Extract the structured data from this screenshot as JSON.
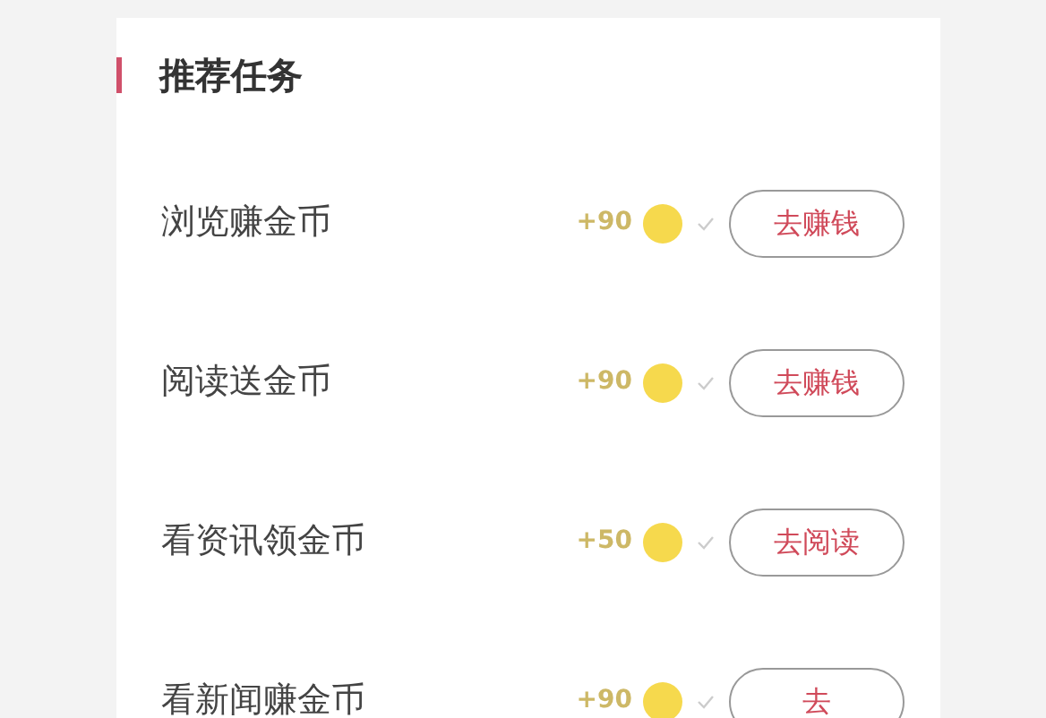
{
  "section": {
    "title": "推荐任务"
  },
  "tasks": [
    {
      "name": "浏览赚金币",
      "reward": "+90",
      "action": "去赚钱"
    },
    {
      "name": "阅读送金币",
      "reward": "+90",
      "action": "去赚钱"
    },
    {
      "name": "看资讯领金币",
      "reward": "+50",
      "action": "去阅读"
    },
    {
      "name": "看新闻赚金币",
      "reward": "+90",
      "action": "去"
    }
  ]
}
